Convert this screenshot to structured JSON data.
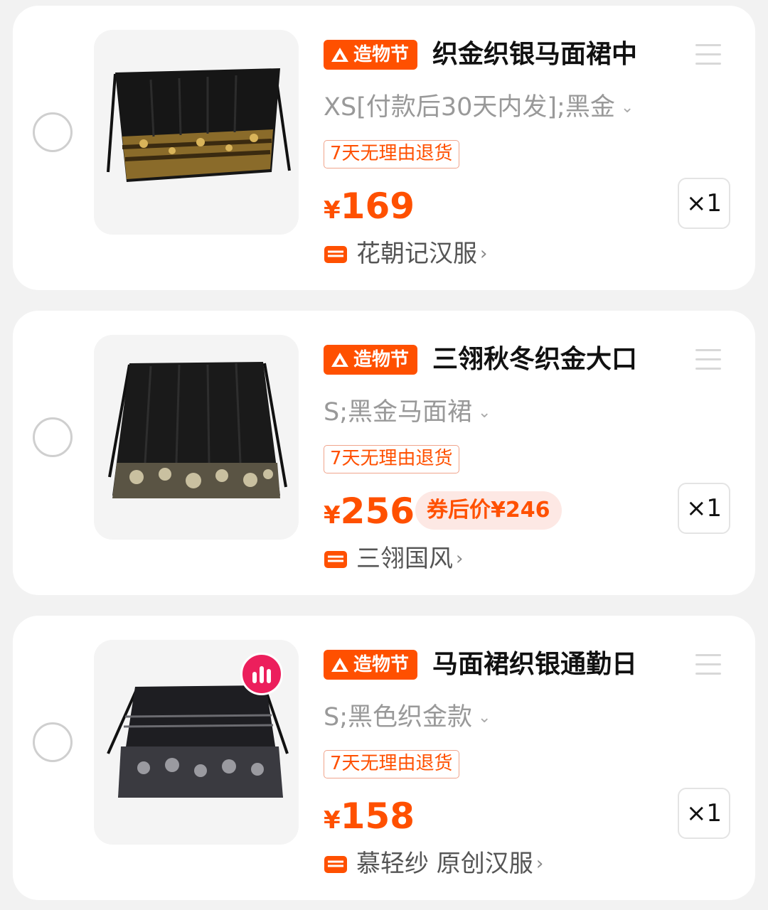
{
  "cart": {
    "items": [
      {
        "festival_tag": "造物节",
        "title": "织金织银马面裙中",
        "sku": "XS[付款后30天内发];黑金",
        "return_policy": "7天无理由退货",
        "currency": "¥",
        "price": "169",
        "coupon_price": "",
        "quantity": "×1",
        "store": "花朝记汉服",
        "image_icon": "skirt-image",
        "selected": false
      },
      {
        "festival_tag": "造物节",
        "title": "三翎秋冬织金大口",
        "sku": "S;黑金马面裙",
        "return_policy": "7天无理由退货",
        "currency": "¥",
        "price": "256",
        "coupon_price": "券后价¥246",
        "quantity": "×1",
        "store": "三翎国风",
        "image_icon": "skirt-image",
        "selected": false
      },
      {
        "festival_tag": "造物节",
        "title": "马面裙织银通勤日",
        "sku": "S;黑色织金款",
        "return_policy": "7天无理由退货",
        "currency": "¥",
        "price": "158",
        "coupon_price": "",
        "quantity": "×1",
        "store": "慕轻纱 原创汉服",
        "image_icon": "skirt-image",
        "badge_icon": "hot-chart-icon",
        "selected": false
      }
    ]
  },
  "colors": {
    "accent": "#ff5000",
    "card_bg": "#ffffff",
    "page_bg": "#f2f2f2",
    "hot_badge": "#ec1f5c"
  }
}
